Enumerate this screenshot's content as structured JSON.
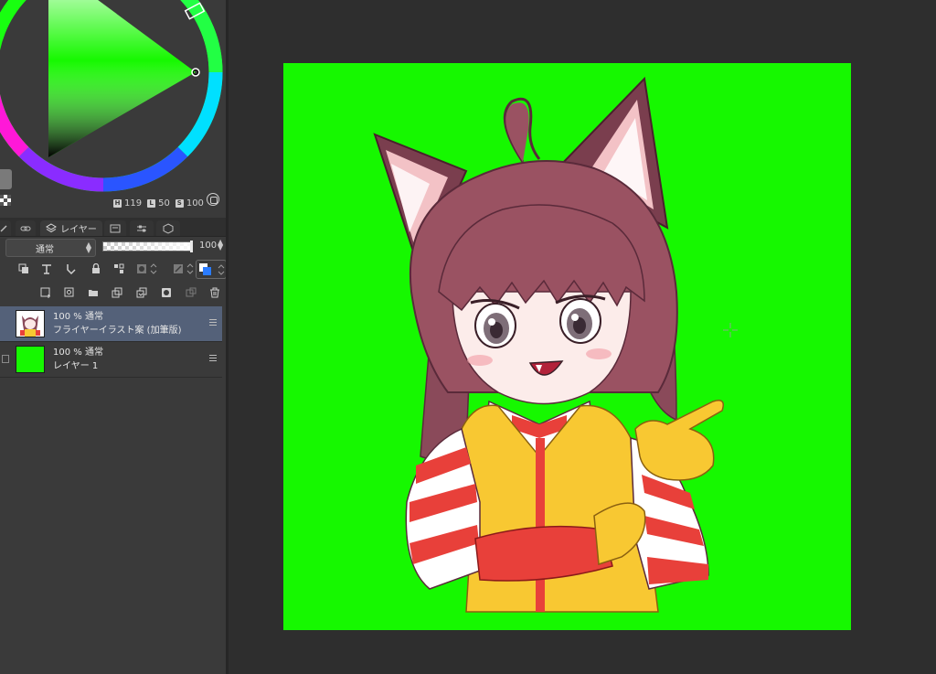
{
  "color_panel": {
    "hsv": [
      {
        "tag": "H",
        "value": "119"
      },
      {
        "tag": "L",
        "value": "50"
      },
      {
        "tag": "S",
        "value": "100"
      }
    ],
    "hue_color": "#16f800"
  },
  "tabs": {
    "layer_label": "レイヤー"
  },
  "layer_properties": {
    "blend_mode": "通常",
    "opacity_value": "100",
    "opacity_fraction": 1.0
  },
  "layers": [
    {
      "meta": "100 % 通常",
      "name": "フライヤーイラスト案 (加筆版)",
      "selected": true,
      "thumb_color": "#ffffff"
    },
    {
      "meta": "100 % 通常",
      "name": "レイヤー 1",
      "selected": false,
      "thumb_color": "#16f800"
    }
  ],
  "canvas": {
    "background_color": "#16f800"
  }
}
